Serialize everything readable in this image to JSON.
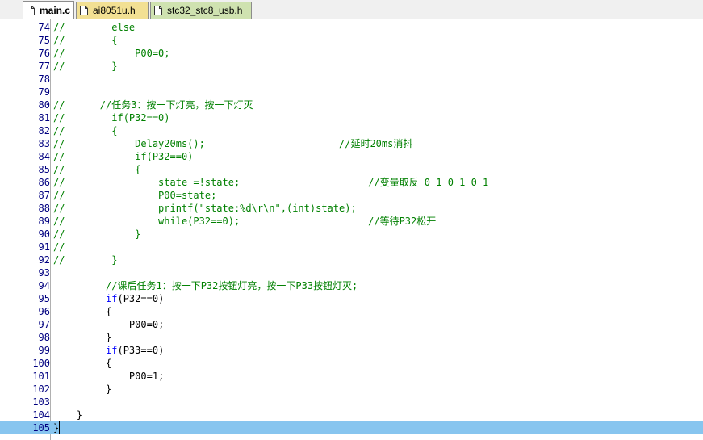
{
  "tabs": [
    {
      "label": "main.c",
      "active": true
    },
    {
      "label": "ai8051u.h",
      "active": false
    },
    {
      "label": "stc32_stc8_usb.h",
      "active": false
    }
  ],
  "lines": [
    {
      "n": "74",
      "segs": [
        {
          "t": "//        else",
          "c": "comment"
        }
      ]
    },
    {
      "n": "75",
      "segs": [
        {
          "t": "//        {",
          "c": "comment"
        }
      ]
    },
    {
      "n": "76",
      "segs": [
        {
          "t": "//            P00=0;",
          "c": "comment"
        }
      ]
    },
    {
      "n": "77",
      "segs": [
        {
          "t": "//        }",
          "c": "comment"
        }
      ]
    },
    {
      "n": "78",
      "segs": []
    },
    {
      "n": "79",
      "segs": []
    },
    {
      "n": "80",
      "segs": [
        {
          "t": "//      //任务3：按一下灯亮，按一下灯灭",
          "c": "comment"
        }
      ]
    },
    {
      "n": "81",
      "segs": [
        {
          "t": "//        if(P32==0)",
          "c": "comment"
        }
      ]
    },
    {
      "n": "82",
      "segs": [
        {
          "t": "//        {",
          "c": "comment"
        }
      ]
    },
    {
      "n": "83",
      "segs": [
        {
          "t": "//            Delay20ms();                       //延时20ms消抖",
          "c": "comment"
        }
      ]
    },
    {
      "n": "84",
      "segs": [
        {
          "t": "//            if(P32==0)",
          "c": "comment"
        }
      ]
    },
    {
      "n": "85",
      "segs": [
        {
          "t": "//            {",
          "c": "comment"
        }
      ]
    },
    {
      "n": "86",
      "segs": [
        {
          "t": "//                state =!state;                      //变量取反 0 1 0 1 0 1",
          "c": "comment"
        }
      ]
    },
    {
      "n": "87",
      "segs": [
        {
          "t": "//                P00=state;",
          "c": "comment"
        }
      ]
    },
    {
      "n": "88",
      "segs": [
        {
          "t": "//                printf(\"state:%d\\r\\n\",(int)state);",
          "c": "comment"
        }
      ]
    },
    {
      "n": "89",
      "segs": [
        {
          "t": "//                while(P32==0);                      //等待P32松开",
          "c": "comment"
        }
      ]
    },
    {
      "n": "90",
      "segs": [
        {
          "t": "//            }",
          "c": "comment"
        }
      ]
    },
    {
      "n": "91",
      "segs": [
        {
          "t": "//",
          "c": "comment"
        }
      ]
    },
    {
      "n": "92",
      "segs": [
        {
          "t": "//        }",
          "c": "comment"
        }
      ]
    },
    {
      "n": "93",
      "segs": []
    },
    {
      "n": "94",
      "segs": [
        {
          "t": "         //课后任务1：按一下P32按钮灯亮，按一下P33按钮灯灭;",
          "c": "comment"
        }
      ]
    },
    {
      "n": "95",
      "segs": [
        {
          "t": "         ",
          "c": "normal"
        },
        {
          "t": "if",
          "c": "kw"
        },
        {
          "t": "(P32==",
          "c": "normal"
        },
        {
          "t": "0",
          "c": "num"
        },
        {
          "t": ")",
          "c": "normal"
        }
      ]
    },
    {
      "n": "96",
      "segs": [
        {
          "t": "         {",
          "c": "normal"
        }
      ]
    },
    {
      "n": "97",
      "segs": [
        {
          "t": "             P00=",
          "c": "normal"
        },
        {
          "t": "0",
          "c": "num"
        },
        {
          "t": ";",
          "c": "normal"
        }
      ]
    },
    {
      "n": "98",
      "segs": [
        {
          "t": "         }",
          "c": "normal"
        }
      ]
    },
    {
      "n": "99",
      "segs": [
        {
          "t": "         ",
          "c": "normal"
        },
        {
          "t": "if",
          "c": "kw"
        },
        {
          "t": "(P33==",
          "c": "normal"
        },
        {
          "t": "0",
          "c": "num"
        },
        {
          "t": ")",
          "c": "normal"
        }
      ]
    },
    {
      "n": "100",
      "segs": [
        {
          "t": "         {",
          "c": "normal"
        }
      ]
    },
    {
      "n": "101",
      "segs": [
        {
          "t": "             P00=",
          "c": "normal"
        },
        {
          "t": "1",
          "c": "num"
        },
        {
          "t": ";",
          "c": "normal"
        }
      ]
    },
    {
      "n": "102",
      "segs": [
        {
          "t": "         }",
          "c": "normal"
        }
      ]
    },
    {
      "n": "103",
      "segs": []
    },
    {
      "n": "104",
      "segs": [
        {
          "t": "    }",
          "c": "normal"
        }
      ]
    },
    {
      "n": "105",
      "segs": [
        {
          "t": "}",
          "c": "normal"
        }
      ],
      "current": true
    }
  ],
  "colors": {
    "comment": "#008000",
    "keyword": "#0000ff",
    "current_line": "#87c5ef"
  },
  "icons": {
    "tab_file": "document-icon"
  }
}
